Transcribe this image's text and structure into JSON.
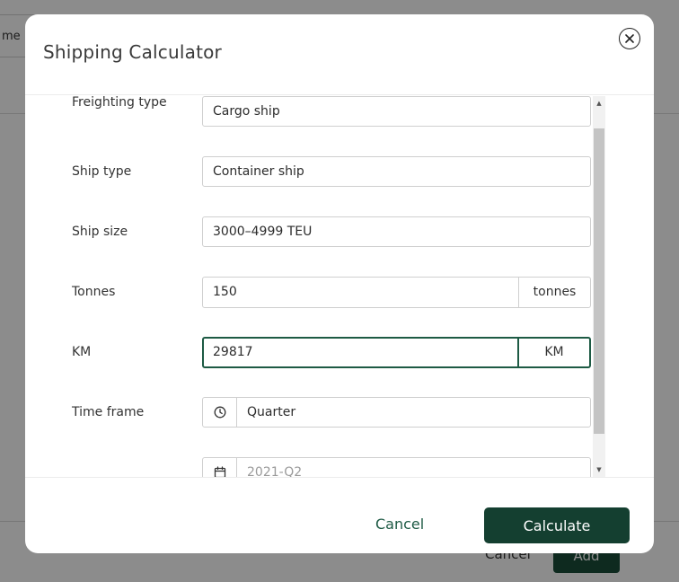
{
  "background": {
    "fragment_text": "me",
    "cancel_label": "Cancel",
    "add_label": "Add"
  },
  "modal": {
    "title": "Shipping Calculator"
  },
  "form": {
    "freighting_type": {
      "label": "Freighting type",
      "value": "Cargo ship"
    },
    "ship_type": {
      "label": "Ship type",
      "value": "Container ship"
    },
    "ship_size": {
      "label": "Ship size",
      "value": "3000–4999 TEU"
    },
    "tonnes": {
      "label": "Tonnes",
      "value": "150",
      "unit": "tonnes"
    },
    "km": {
      "label": "KM",
      "value": "29817",
      "unit": "KM"
    },
    "time_frame": {
      "label": "Time frame",
      "value": "Quarter"
    },
    "period": {
      "value": "2021-Q2"
    }
  },
  "footer": {
    "cancel_label": "Cancel",
    "calculate_label": "Calculate"
  },
  "colors": {
    "accent": "#1d5a44",
    "primary_button": "#143f30"
  }
}
